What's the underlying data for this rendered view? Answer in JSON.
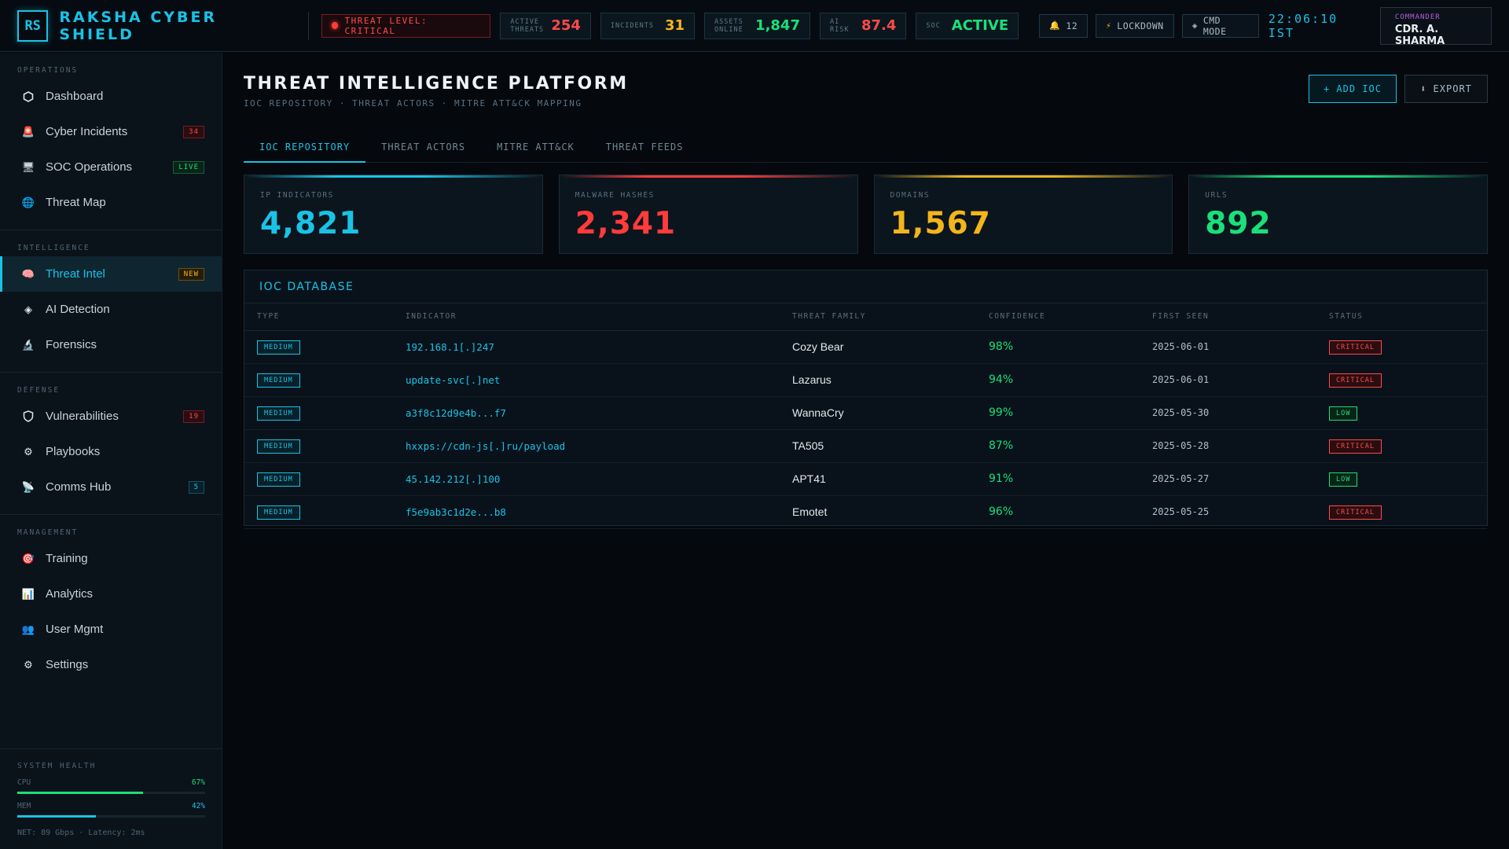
{
  "brand": {
    "logo": "RS",
    "name": "RAKSHA CYBER SHIELD"
  },
  "topbar": {
    "threat_level": "THREAT LEVEL: CRITICAL",
    "stats": [
      {
        "label": "ACTIVE THREATS",
        "value": "254",
        "color": "#ff4a4a"
      },
      {
        "label": "INCIDENTS",
        "value": "31",
        "color": "#f2b51c"
      },
      {
        "label": "ASSETS ONLINE",
        "value": "1,847",
        "color": "#19e07a"
      },
      {
        "label": "AI RISK",
        "value": "87.4",
        "color": "#ff4a4a"
      },
      {
        "label": "SOC",
        "value": "ACTIVE",
        "color": "#19e07a"
      }
    ],
    "notifications": "12",
    "lockdown_label": "LOCKDOWN",
    "cmd_mode_label": "CMD MODE",
    "clock": "22:06:10 IST",
    "commander_role": "COMMANDER",
    "commander_name": "CDR. A. SHARMA"
  },
  "sidebar": {
    "sections": [
      {
        "title": "OPERATIONS",
        "items": [
          {
            "label": "Dashboard",
            "icon": "hexagon-icon",
            "badge": ""
          },
          {
            "label": "Cyber Incidents",
            "icon": "siren-icon",
            "badge": "34"
          },
          {
            "label": "SOC Operations",
            "icon": "server-icon",
            "badge": "LIVE"
          },
          {
            "label": "Threat Map",
            "icon": "globe-icon",
            "badge": ""
          }
        ]
      },
      {
        "title": "INTELLIGENCE",
        "items": [
          {
            "label": "Threat Intel",
            "icon": "brain-icon",
            "badge": "NEW"
          },
          {
            "label": "AI Detection",
            "icon": "diamond-icon",
            "badge": ""
          },
          {
            "label": "Forensics",
            "icon": "microscope-icon",
            "badge": ""
          }
        ]
      },
      {
        "title": "DEFENSE",
        "items": [
          {
            "label": "Vulnerabilities",
            "icon": "shield-icon",
            "badge": "19"
          },
          {
            "label": "Playbooks",
            "icon": "gear-icon",
            "badge": ""
          },
          {
            "label": "Comms Hub",
            "icon": "satellite-icon",
            "badge": "5"
          }
        ]
      },
      {
        "title": "MANAGEMENT",
        "items": [
          {
            "label": "Training",
            "icon": "target-icon",
            "badge": ""
          },
          {
            "label": "Analytics",
            "icon": "bar-chart-icon",
            "badge": ""
          },
          {
            "label": "User Mgmt",
            "icon": "users-icon",
            "badge": ""
          },
          {
            "label": "Settings",
            "icon": "gear-icon",
            "badge": ""
          }
        ]
      }
    ],
    "health": {
      "title": "SYSTEM HEALTH",
      "cpu_label": "CPU",
      "cpu_value": "67%",
      "cpu_fraction": 0.67,
      "mem_label": "MEM",
      "mem_value": "42%",
      "mem_fraction": 0.42,
      "net": "NET: 89 Gbps · Latency: 2ms"
    }
  },
  "main": {
    "title": "THREAT INTELLIGENCE PLATFORM",
    "subtitle": "IOC REPOSITORY · THREAT ACTORS · MITRE ATT&CK MAPPING",
    "add_ioc_label": "+ ADD IOC",
    "export_label": "⬇ EXPORT",
    "tabs": [
      "IOC REPOSITORY",
      "THREAT ACTORS",
      "MITRE ATT&CK",
      "THREAT FEEDS"
    ],
    "cards": [
      {
        "label": "IP INDICATORS",
        "value": "4,821",
        "color": "#19c3e6"
      },
      {
        "label": "MALWARE HASHES",
        "value": "2,341",
        "color": "#ff3b3b"
      },
      {
        "label": "DOMAINS",
        "value": "1,567",
        "color": "#f2b51c"
      },
      {
        "label": "URLS",
        "value": "892",
        "color": "#19e07a"
      }
    ],
    "table": {
      "title": "IOC DATABASE",
      "headers": [
        "TYPE",
        "INDICATOR",
        "THREAT FAMILY",
        "CONFIDENCE",
        "FIRST SEEN",
        "STATUS"
      ],
      "rows": [
        {
          "type": "MEDIUM",
          "indicator": "192.168.1[.]247",
          "family": "Cozy Bear",
          "confidence": "98%",
          "first_seen": "2025-06-01",
          "status": "CRITICAL"
        },
        {
          "type": "MEDIUM",
          "indicator": "update-svc[.]net",
          "family": "Lazarus",
          "confidence": "94%",
          "first_seen": "2025-06-01",
          "status": "CRITICAL"
        },
        {
          "type": "MEDIUM",
          "indicator": "a3f8c12d9e4b...f7",
          "family": "WannaCry",
          "confidence": "99%",
          "first_seen": "2025-05-30",
          "status": "LOW"
        },
        {
          "type": "MEDIUM",
          "indicator": "hxxps://cdn-js[.]ru/payload",
          "family": "TA505",
          "confidence": "87%",
          "first_seen": "2025-05-28",
          "status": "CRITICAL"
        },
        {
          "type": "MEDIUM",
          "indicator": "45.142.212[.]100",
          "family": "APT41",
          "confidence": "91%",
          "first_seen": "2025-05-27",
          "status": "LOW"
        },
        {
          "type": "MEDIUM",
          "indicator": "f5e9ab3c1d2e...b8",
          "family": "Emotet",
          "confidence": "96%",
          "first_seen": "2025-05-25",
          "status": "CRITICAL"
        }
      ]
    }
  },
  "colors": {
    "accent": "#19c3e6",
    "critical": "#ff4a4a",
    "ok": "#19e07a",
    "warn": "#f2b51c"
  }
}
